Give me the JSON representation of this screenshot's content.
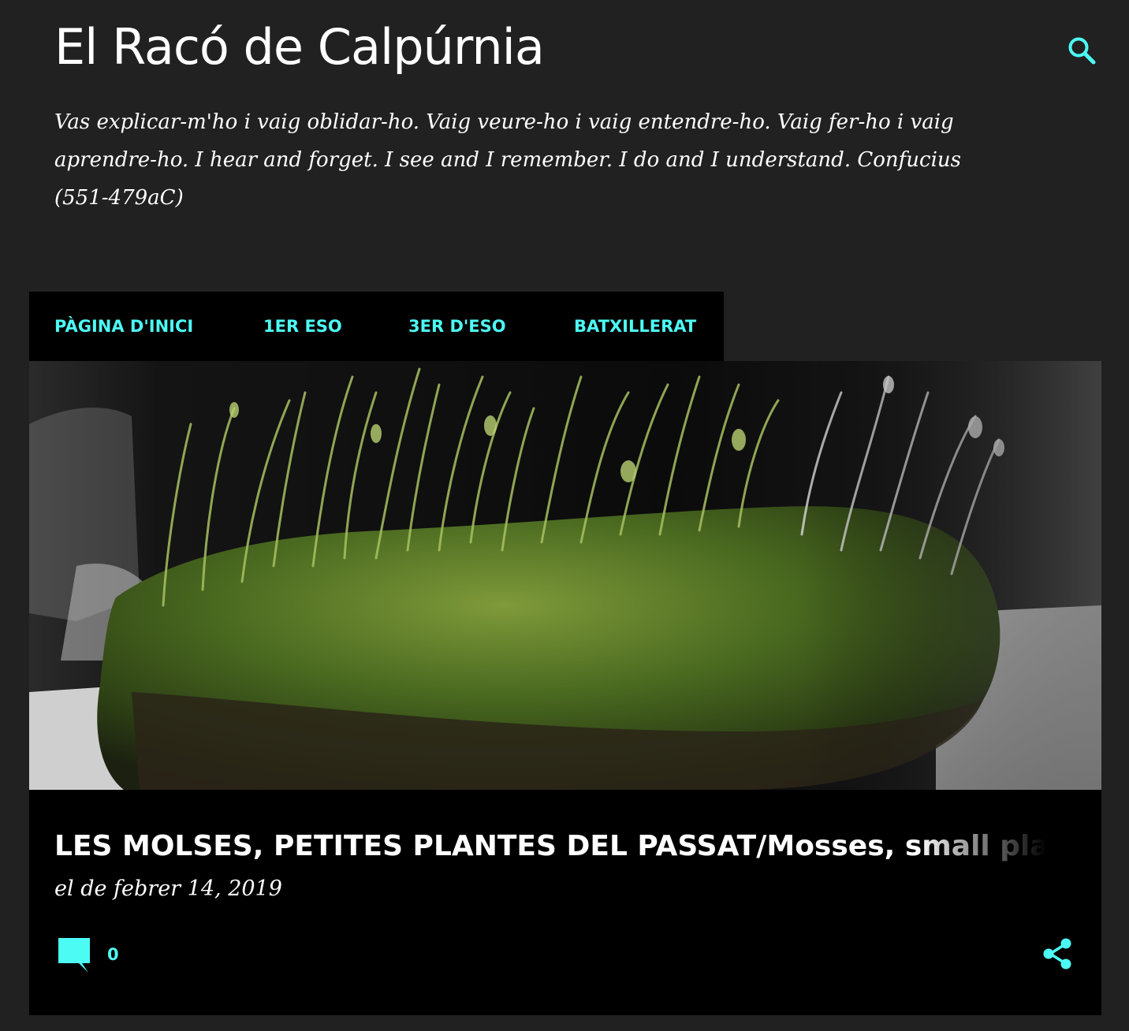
{
  "header": {
    "blog_title": "El Racó de Calpúrnia",
    "description": "Vas explicar-m'ho i vaig oblidar-ho. Vaig veure-ho i vaig entendre-ho. Vaig fer-ho i vaig aprendre-ho. I hear and forget. I see and I remember. I do and I understand. Confucius (551-479aC)",
    "search_icon": "search-icon"
  },
  "nav": {
    "items": [
      {
        "label": "PÀGINA D'INICI"
      },
      {
        "label": "1ER ESO"
      },
      {
        "label": "3ER D'ESO"
      },
      {
        "label": "BATXILLERAT"
      }
    ]
  },
  "post": {
    "title": "LES MOLSES, PETITES PLANTES DEL PASSAT/Mosses, small plants of",
    "date": "el de febrer 14, 2019",
    "comment_count": "0",
    "comment_icon": "comment-icon",
    "share_icon": "share-icon"
  },
  "colors": {
    "background": "#212121",
    "card": "#000000",
    "accent": "#4dfbf5",
    "text": "#ffffff"
  }
}
